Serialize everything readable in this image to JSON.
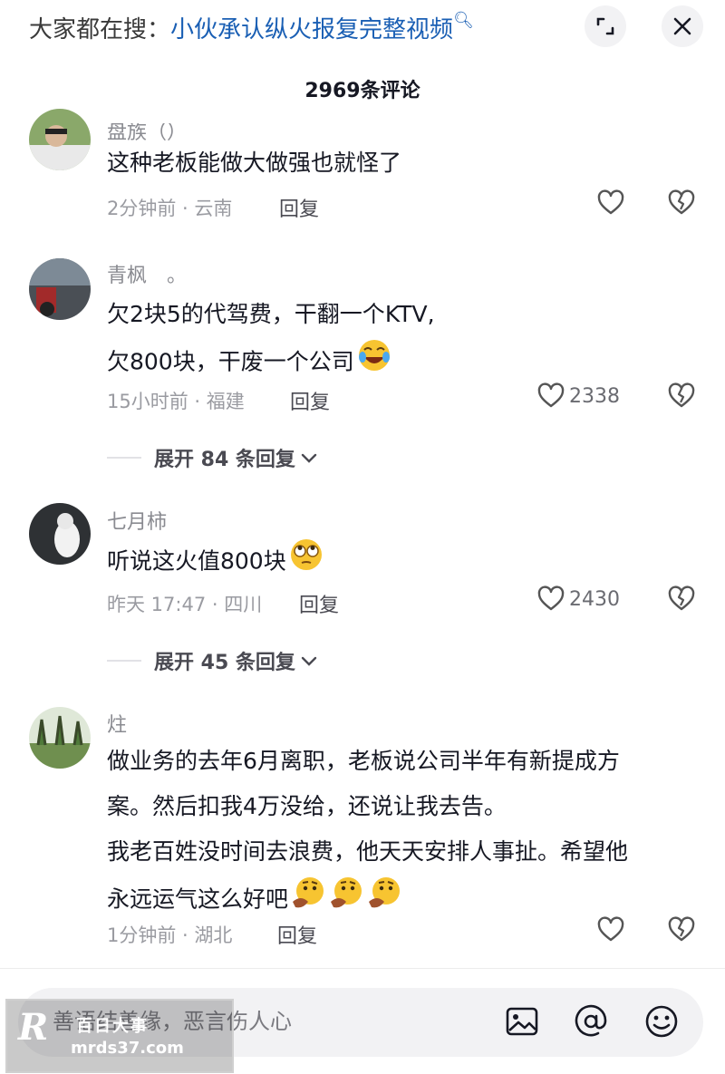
{
  "header": {
    "search_prefix": "大家都在搜：",
    "search_query": "小伙承认纵火报复完整视频",
    "comment_count_title": "2969条评论"
  },
  "comments": [
    {
      "username": "盘族（）",
      "lines": [
        "这种老板能做大做强也就怪了"
      ],
      "time_location": "2分钟前 · 云南",
      "reply_label": "回复",
      "like_count": ""
    },
    {
      "username": "青枫　。",
      "lines": [
        "欠2块5的代驾费，干翻一个KTV,",
        "欠800块，干废一个公司"
      ],
      "time_location": "15小时前 · 福建",
      "reply_label": "回复",
      "like_count": "2338",
      "expand_label": "展开 84 条回复"
    },
    {
      "username": "七月柿",
      "lines": [
        "听说这火值800块"
      ],
      "time_location": "昨天 17:47 · 四川",
      "reply_label": "回复",
      "like_count": "2430",
      "expand_label": "展开 45 条回复"
    },
    {
      "username": "炷",
      "lines": [
        "做业务的去年6月离职，老板说公司半年有新提成方",
        "案。然后扣我4万没给，还说让我去告。",
        "我老百姓没时间去浪费，他天天安排人事扯。希望他",
        "永远运气这么好吧"
      ],
      "time_location": "1分钟前 · 湖北",
      "reply_label": "回复",
      "like_count": ""
    }
  ],
  "input": {
    "placeholder": "善语结善缘，恶言伤人心"
  },
  "watermark": {
    "logo": "R",
    "name": "百日大事",
    "url": "mrds37.com"
  },
  "icons": {
    "expand": "expand-icon",
    "close": "close-icon",
    "like": "heart-icon",
    "dislike": "broken-heart-icon",
    "image": "image-icon",
    "mention": "at-icon",
    "emoji": "emoji-icon"
  },
  "colors": {
    "accent_link": "#1a5fb4",
    "secondary_text": "#9a9ba1",
    "emoji_yellow": "#f7c431"
  }
}
